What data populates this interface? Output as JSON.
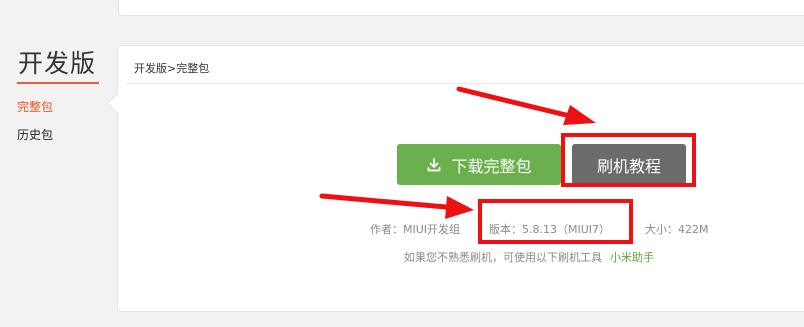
{
  "sidebar": {
    "title": "开发版",
    "items": [
      {
        "label": "完整包"
      },
      {
        "label": "历史包"
      }
    ]
  },
  "breadcrumb": "开发版>完整包",
  "buttons": {
    "download_label": "下载完整包",
    "tutorial_label": "刷机教程"
  },
  "info": {
    "author": "作者：MIUI开发组",
    "version": "版本：5.8.13（MIUI7）",
    "size": "大小：422M"
  },
  "tip": {
    "text": "如果您不熟悉刷机，可使用以下刷机工具",
    "link": "小米助手"
  },
  "colors": {
    "accent": "#e4572a",
    "download_button": "#6ab04c",
    "tutorial_button": "#6b6b6b",
    "annotation": "#ee1111",
    "link": "#5fa23c"
  },
  "icons": {
    "download": "download-icon",
    "annotation_arrow": "red-arrow"
  }
}
